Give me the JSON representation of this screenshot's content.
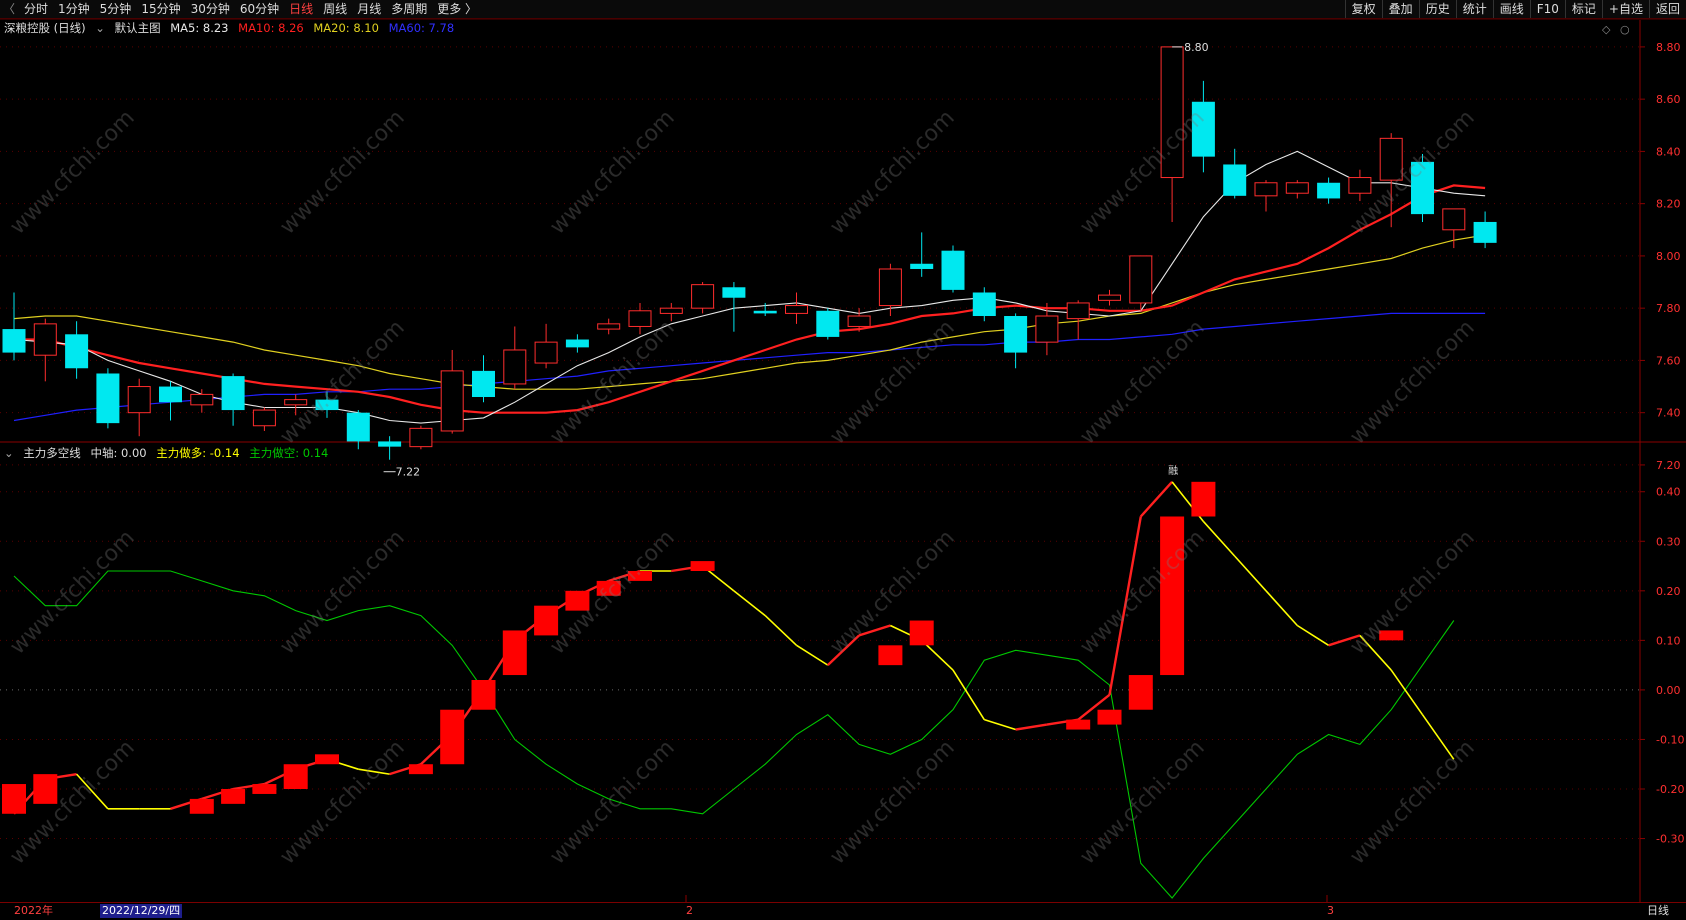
{
  "toolbar": {
    "left_items": [
      "分时",
      "1分钟",
      "5分钟",
      "15分钟",
      "30分钟",
      "60分钟",
      "日线",
      "周线",
      "月线",
      "多周期",
      "更多 〉"
    ],
    "active": "日线",
    "right_items": [
      "复权",
      "叠加",
      "历史",
      "统计",
      "画线",
      "F10",
      "标记",
      "+自选",
      "返回"
    ]
  },
  "main_info": {
    "stock": "深粮控股 (日线)",
    "template": "默认主图",
    "ma5": "MA5: 8.23",
    "ma10": "MA10: 8.26",
    "ma20": "MA20: 8.10",
    "ma60": "MA60: 7.78"
  },
  "sub_info": {
    "name": "主力多空线",
    "axis": "中轴: 0.00",
    "long": "主力做多: -0.14",
    "short": "主力做空: 0.14"
  },
  "annotations": {
    "high": "8.80",
    "low": "7.22",
    "event": "融"
  },
  "bottom": {
    "year": "2022年",
    "date": "2022/12/29/四",
    "m2": "2",
    "m3": "3",
    "period": "日线"
  },
  "watermark": "www.cfchi.com",
  "colors": {
    "up": "#ff2d2d",
    "down": "#00e8f0",
    "ma5": "#e8e8e8",
    "ma10": "#ff2020",
    "ma20": "#e0d020",
    "ma60": "#2020ff",
    "long": "#ffff00",
    "short": "#00c800"
  },
  "chart_data": [
    {
      "type": "candlestick",
      "title": "深粮控股 (日线)",
      "ylim": [
        7.15,
        8.88
      ],
      "yticks": [
        7.2,
        7.4,
        7.6,
        7.8,
        8.0,
        8.2,
        8.4,
        8.6,
        8.8
      ],
      "candles": [
        {
          "o": 7.72,
          "c": 7.63,
          "h": 7.86,
          "l": 7.6
        },
        {
          "o": 7.62,
          "c": 7.74,
          "h": 7.76,
          "l": 7.52
        },
        {
          "o": 7.7,
          "c": 7.57,
          "h": 7.75,
          "l": 7.53
        },
        {
          "o": 7.55,
          "c": 7.36,
          "h": 7.57,
          "l": 7.34
        },
        {
          "o": 7.4,
          "c": 7.5,
          "h": 7.53,
          "l": 7.31
        },
        {
          "o": 7.5,
          "c": 7.44,
          "h": 7.52,
          "l": 7.37
        },
        {
          "o": 7.43,
          "c": 7.47,
          "h": 7.49,
          "l": 7.4
        },
        {
          "o": 7.54,
          "c": 7.41,
          "h": 7.55,
          "l": 7.35
        },
        {
          "o": 7.35,
          "c": 7.41,
          "h": 7.42,
          "l": 7.33
        },
        {
          "o": 7.43,
          "c": 7.45,
          "h": 7.47,
          "l": 7.39
        },
        {
          "o": 7.45,
          "c": 7.41,
          "h": 7.48,
          "l": 7.38
        },
        {
          "o": 7.4,
          "c": 7.29,
          "h": 7.41,
          "l": 7.26
        },
        {
          "o": 7.29,
          "c": 7.27,
          "h": 7.31,
          "l": 7.22
        },
        {
          "o": 7.27,
          "c": 7.34,
          "h": 7.35,
          "l": 7.26
        },
        {
          "o": 7.33,
          "c": 7.56,
          "h": 7.64,
          "l": 7.32
        },
        {
          "o": 7.56,
          "c": 7.46,
          "h": 7.62,
          "l": 7.44
        },
        {
          "o": 7.51,
          "c": 7.64,
          "h": 7.73,
          "l": 7.49
        },
        {
          "o": 7.59,
          "c": 7.67,
          "h": 7.74,
          "l": 7.57
        },
        {
          "o": 7.68,
          "c": 7.65,
          "h": 7.7,
          "l": 7.63
        },
        {
          "o": 7.72,
          "c": 7.74,
          "h": 7.76,
          "l": 7.7
        },
        {
          "o": 7.73,
          "c": 7.79,
          "h": 7.82,
          "l": 7.7
        },
        {
          "o": 7.78,
          "c": 7.8,
          "h": 7.82,
          "l": 7.75
        },
        {
          "o": 7.8,
          "c": 7.89,
          "h": 7.9,
          "l": 7.78
        },
        {
          "o": 7.88,
          "c": 7.84,
          "h": 7.9,
          "l": 7.71
        },
        {
          "o": 7.79,
          "c": 7.78,
          "h": 7.82,
          "l": 7.77
        },
        {
          "o": 7.78,
          "c": 7.81,
          "h": 7.86,
          "l": 7.74
        },
        {
          "o": 7.79,
          "c": 7.69,
          "h": 7.8,
          "l": 7.68
        },
        {
          "o": 7.73,
          "c": 7.77,
          "h": 7.8,
          "l": 7.71
        },
        {
          "o": 7.81,
          "c": 7.95,
          "h": 7.97,
          "l": 7.77
        },
        {
          "o": 7.97,
          "c": 7.95,
          "h": 8.09,
          "l": 7.92
        },
        {
          "o": 8.02,
          "c": 7.87,
          "h": 8.04,
          "l": 7.86
        },
        {
          "o": 7.86,
          "c": 7.77,
          "h": 7.88,
          "l": 7.75
        },
        {
          "o": 7.77,
          "c": 7.63,
          "h": 7.78,
          "l": 7.57
        },
        {
          "o": 7.67,
          "c": 7.77,
          "h": 7.82,
          "l": 7.62
        },
        {
          "o": 7.76,
          "c": 7.82,
          "h": 7.83,
          "l": 7.68
        },
        {
          "o": 7.83,
          "c": 7.85,
          "h": 7.87,
          "l": 7.81
        },
        {
          "o": 7.82,
          "c": 8.0,
          "h": 8.0,
          "l": 7.79
        },
        {
          "o": 8.3,
          "c": 8.8,
          "h": 8.8,
          "l": 8.13
        },
        {
          "o": 8.59,
          "c": 8.38,
          "h": 8.67,
          "l": 8.32
        },
        {
          "o": 8.35,
          "c": 8.23,
          "h": 8.41,
          "l": 8.22
        },
        {
          "o": 8.23,
          "c": 8.28,
          "h": 8.29,
          "l": 8.17
        },
        {
          "o": 8.24,
          "c": 8.28,
          "h": 8.29,
          "l": 8.22
        },
        {
          "o": 8.28,
          "c": 8.22,
          "h": 8.3,
          "l": 8.2
        },
        {
          "o": 8.24,
          "c": 8.3,
          "h": 8.33,
          "l": 8.21
        },
        {
          "o": 8.29,
          "c": 8.45,
          "h": 8.47,
          "l": 8.11
        },
        {
          "o": 8.36,
          "c": 8.16,
          "h": 8.39,
          "l": 8.13
        },
        {
          "o": 8.1,
          "c": 8.18,
          "h": 8.18,
          "l": 8.03
        },
        {
          "o": 8.13,
          "c": 8.05,
          "h": 8.17,
          "l": 8.03
        }
      ],
      "ma5": [
        7.68,
        7.67,
        7.66,
        7.6,
        7.56,
        7.52,
        7.47,
        7.44,
        7.42,
        7.42,
        7.42,
        7.4,
        7.37,
        7.36,
        7.37,
        7.38,
        7.44,
        7.51,
        7.58,
        7.63,
        7.69,
        7.74,
        7.77,
        7.8,
        7.81,
        7.82,
        7.8,
        7.78,
        7.8,
        7.81,
        7.83,
        7.84,
        7.82,
        7.79,
        7.78,
        7.77,
        7.79,
        7.97,
        8.15,
        8.28,
        8.35,
        8.4,
        8.34,
        8.28,
        8.28,
        8.26,
        8.24,
        8.23
      ],
      "ma10": [
        7.68,
        7.68,
        7.65,
        7.62,
        7.59,
        7.57,
        7.55,
        7.53,
        7.51,
        7.5,
        7.49,
        7.48,
        7.46,
        7.43,
        7.41,
        7.4,
        7.4,
        7.4,
        7.41,
        7.44,
        7.48,
        7.52,
        7.56,
        7.6,
        7.64,
        7.68,
        7.71,
        7.72,
        7.74,
        7.77,
        7.78,
        7.8,
        7.81,
        7.8,
        7.8,
        7.79,
        7.79,
        7.81,
        7.86,
        7.91,
        7.94,
        7.97,
        8.03,
        8.1,
        8.16,
        8.23,
        8.27,
        8.26
      ],
      "ma20": [
        7.76,
        7.77,
        7.77,
        7.75,
        7.73,
        7.71,
        7.69,
        7.67,
        7.64,
        7.62,
        7.6,
        7.58,
        7.55,
        7.53,
        7.51,
        7.5,
        7.49,
        7.49,
        7.49,
        7.5,
        7.51,
        7.52,
        7.53,
        7.55,
        7.57,
        7.59,
        7.6,
        7.62,
        7.64,
        7.67,
        7.69,
        7.71,
        7.72,
        7.74,
        7.75,
        7.77,
        7.78,
        7.82,
        7.86,
        7.89,
        7.91,
        7.93,
        7.95,
        7.97,
        7.99,
        8.03,
        8.06,
        8.08
      ],
      "ma60": [
        7.37,
        7.39,
        7.41,
        7.42,
        7.43,
        7.44,
        7.45,
        7.46,
        7.47,
        7.47,
        7.48,
        7.48,
        7.49,
        7.49,
        7.5,
        7.51,
        7.52,
        7.53,
        7.54,
        7.56,
        7.57,
        7.58,
        7.59,
        7.6,
        7.61,
        7.62,
        7.63,
        7.63,
        7.64,
        7.65,
        7.66,
        7.66,
        7.67,
        7.67,
        7.68,
        7.68,
        7.69,
        7.7,
        7.72,
        7.73,
        7.74,
        7.75,
        7.76,
        7.77,
        7.78,
        7.78,
        7.78,
        7.78
      ]
    },
    {
      "type": "line",
      "title": "主力多空线",
      "ylim": [
        -0.42,
        0.46
      ],
      "yticks": [
        -0.3,
        -0.2,
        -0.1,
        0.0,
        0.1,
        0.2,
        0.3,
        0.4
      ],
      "series": [
        {
          "name": "主力做多",
          "values": [
            -0.25,
            -0.18,
            -0.17,
            -0.24,
            -0.24,
            -0.24,
            -0.22,
            -0.2,
            -0.19,
            -0.16,
            -0.14,
            -0.16,
            -0.17,
            -0.15,
            -0.09,
            0.0,
            0.1,
            0.15,
            0.19,
            0.22,
            0.24,
            0.24,
            0.25,
            0.2,
            0.15,
            0.09,
            0.05,
            0.11,
            0.13,
            0.1,
            0.04,
            -0.06,
            -0.08,
            -0.07,
            -0.06,
            -0.01,
            0.35,
            0.42,
            0.34,
            0.27,
            0.2,
            0.13,
            0.09,
            0.11,
            0.04,
            -0.05,
            -0.14
          ]
        },
        {
          "name": "主力做空",
          "values": [
            0.23,
            0.17,
            0.17,
            0.24,
            0.24,
            0.24,
            0.22,
            0.2,
            0.19,
            0.16,
            0.14,
            0.16,
            0.17,
            0.15,
            0.09,
            0.0,
            -0.1,
            -0.15,
            -0.19,
            -0.22,
            -0.24,
            -0.24,
            -0.25,
            -0.2,
            -0.15,
            -0.09,
            -0.05,
            -0.11,
            -0.13,
            -0.1,
            -0.04,
            0.06,
            0.08,
            0.07,
            0.06,
            0.01,
            -0.35,
            -0.42,
            -0.34,
            -0.27,
            -0.2,
            -0.13,
            -0.09,
            -0.11,
            -0.04,
            0.05,
            0.14
          ]
        }
      ],
      "red_bars": [
        {
          "i": 0,
          "top": -0.19,
          "bottom": -0.25
        },
        {
          "i": 1,
          "top": -0.17,
          "bottom": -0.23
        },
        {
          "i": 6,
          "top": -0.22,
          "bottom": -0.25
        },
        {
          "i": 7,
          "top": -0.2,
          "bottom": -0.23
        },
        {
          "i": 8,
          "top": -0.19,
          "bottom": -0.21
        },
        {
          "i": 9,
          "top": -0.15,
          "bottom": -0.2
        },
        {
          "i": 10,
          "top": -0.13,
          "bottom": -0.15
        },
        {
          "i": 13,
          "top": -0.15,
          "bottom": -0.17
        },
        {
          "i": 14,
          "top": -0.04,
          "bottom": -0.15
        },
        {
          "i": 15,
          "top": 0.02,
          "bottom": -0.04
        },
        {
          "i": 16,
          "top": 0.12,
          "bottom": 0.03
        },
        {
          "i": 17,
          "top": 0.17,
          "bottom": 0.11
        },
        {
          "i": 18,
          "top": 0.2,
          "bottom": 0.16
        },
        {
          "i": 19,
          "top": 0.22,
          "bottom": 0.19
        },
        {
          "i": 20,
          "top": 0.24,
          "bottom": 0.22
        },
        {
          "i": 22,
          "top": 0.26,
          "bottom": 0.24
        },
        {
          "i": 28,
          "top": 0.09,
          "bottom": 0.05
        },
        {
          "i": 29,
          "top": 0.14,
          "bottom": 0.09
        },
        {
          "i": 34,
          "top": -0.06,
          "bottom": -0.08
        },
        {
          "i": 35,
          "top": -0.04,
          "bottom": -0.07
        },
        {
          "i": 36,
          "top": 0.03,
          "bottom": -0.04
        },
        {
          "i": 37,
          "top": 0.35,
          "bottom": 0.03
        },
        {
          "i": 38,
          "top": 0.42,
          "bottom": 0.35
        },
        {
          "i": 44,
          "top": 0.12,
          "bottom": 0.1
        }
      ]
    }
  ]
}
